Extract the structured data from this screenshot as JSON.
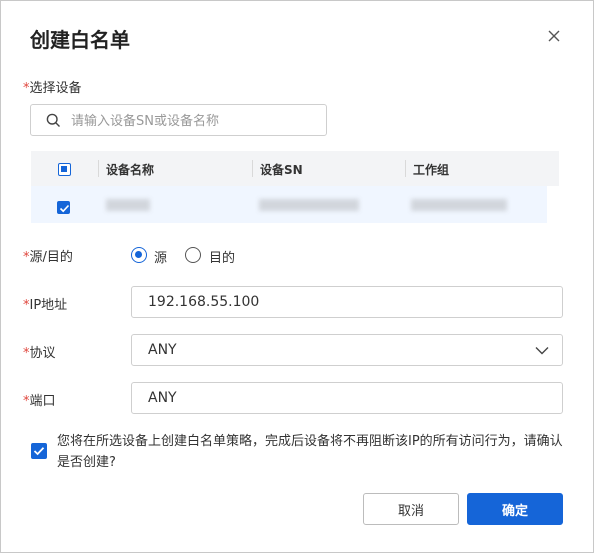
{
  "dialog": {
    "title": "创建白名单",
    "close_icon": "close-icon"
  },
  "required_mark": "*",
  "device_select": {
    "label": "选择设备",
    "search_placeholder": "请输入设备SN或设备名称",
    "columns": [
      "设备名称",
      "设备SN",
      "工作组"
    ],
    "header_checkbox": "partial",
    "rows": [
      {
        "checked": true
      }
    ]
  },
  "direction": {
    "label": "源/目的",
    "options": [
      {
        "label": "源",
        "selected": true
      },
      {
        "label": "目的",
        "selected": false
      }
    ]
  },
  "ip": {
    "label": "IP地址",
    "value": "192.168.55.100"
  },
  "protocol": {
    "label": "协议",
    "value": "ANY"
  },
  "port": {
    "label": "端口",
    "value": "ANY"
  },
  "confirm": {
    "checked": true,
    "text": "您将在所选设备上创建白名单策略，完成后设备将不再阻断该IP的所有访问行为，请确认是否创建?"
  },
  "buttons": {
    "cancel": "取消",
    "ok": "确定"
  },
  "colors": {
    "primary": "#1565d8",
    "required": "#e0463d"
  }
}
